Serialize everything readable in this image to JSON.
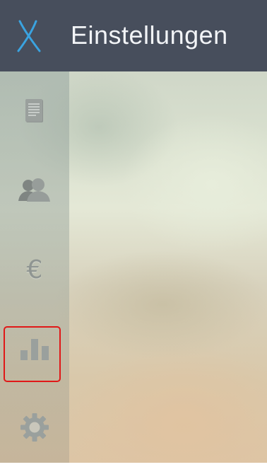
{
  "header": {
    "title": "Einstellungen",
    "background": "#474e5c",
    "logo_icon": "x-logo-icon",
    "logo_color": "#3aa3e0"
  },
  "sidebar": {
    "items": [
      {
        "icon": "document-icon",
        "selected": false
      },
      {
        "icon": "user-icon",
        "selected": false
      },
      {
        "icon": "euro-icon",
        "glyph": "€",
        "selected": false
      },
      {
        "icon": "bar-chart-icon",
        "selected": false
      },
      {
        "icon": "gear-icon",
        "selected": true
      }
    ],
    "selection_outline_color": "#e01818"
  }
}
